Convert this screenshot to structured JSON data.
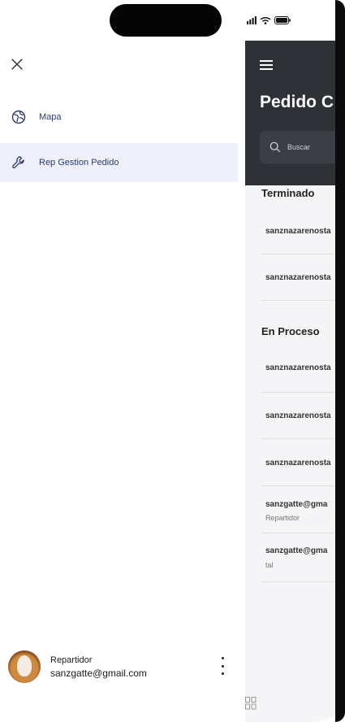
{
  "drawer": {
    "close_icon": "close-icon",
    "items": [
      {
        "label": "Mapa",
        "icon": "globe-icon",
        "active": false
      },
      {
        "label": "Rep Gestion Pedido",
        "icon": "wrench-icon",
        "active": true
      }
    ],
    "user": {
      "role": "Repartidor",
      "email": "sanzgatte@gmail.com"
    }
  },
  "phone": {
    "title": "Pedido C",
    "search_placeholder": "Buscar",
    "sections": [
      {
        "title": "Terminado",
        "rows": [
          {
            "primary": "sanznazarenosta",
            "secondary": ""
          },
          {
            "primary": "sanznazarenosta",
            "secondary": ""
          }
        ]
      },
      {
        "title": "En Proceso",
        "rows": [
          {
            "primary": "sanznazarenosta",
            "secondary": ""
          },
          {
            "primary": "sanznazarenosta",
            "secondary": ""
          },
          {
            "primary": "sanznazarenosta",
            "secondary": ""
          },
          {
            "primary": "sanzgatte@gma",
            "secondary": "Repartidor"
          },
          {
            "primary": "sanzgatte@gma",
            "secondary": "tal"
          }
        ]
      }
    ]
  },
  "colors": {
    "drawer_active_bg": "#eef0fb",
    "menu_text": "#2c3a6b",
    "phone_header": "#2e3136",
    "phone_bg": "#f5f5f7"
  }
}
